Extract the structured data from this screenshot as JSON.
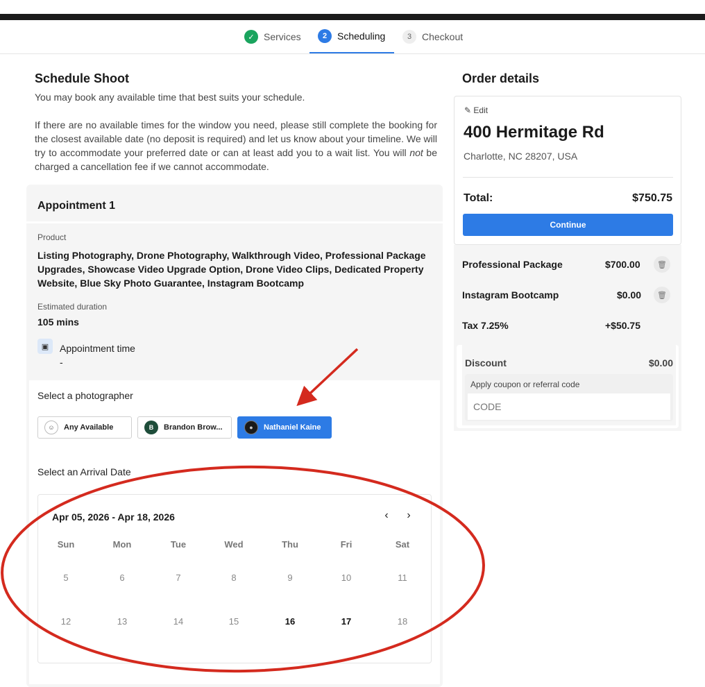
{
  "stepper": {
    "steps": [
      {
        "num": "✓",
        "label": "Services"
      },
      {
        "num": "2",
        "label": "Scheduling"
      },
      {
        "num": "3",
        "label": "Checkout"
      }
    ]
  },
  "schedule": {
    "title": "Schedule Shoot",
    "subtitle": "You may book any available time that best suits your schedule.",
    "para_before": "If there are no available times for the window you need, please still complete the booking for the closest available date (no deposit is required) and let us know about your timeline. We will try to accommodate your preferred date or can at least add you to a wait list. You will ",
    "para_emphasis": "not",
    "para_after": " be charged a cancellation fee if we cannot accommodate."
  },
  "appointment": {
    "title": "Appointment 1",
    "product_label": "Product",
    "product_value": "Listing Photography, Drone Photography, Walkthrough Video, Professional Package Upgrades, Showcase Video Upgrade Option, Drone Video Clips, Dedicated Property Website, Blue Sky Photo Guarantee, Instagram Bootcamp",
    "duration_label": "Estimated duration",
    "duration_value": "105 mins",
    "time_label": "Appointment time",
    "time_value": "-"
  },
  "photographer": {
    "label": "Select a photographer",
    "options": [
      {
        "avatar": "",
        "name": "Any Available"
      },
      {
        "avatar": "B",
        "name": "Brandon Brow..."
      },
      {
        "avatar": "",
        "name": "Nathaniel Kaine",
        "selected": true
      }
    ]
  },
  "calendar": {
    "label": "Select an Arrival Date",
    "range": "Apr 05, 2026 - Apr 18, 2026",
    "weekdays": [
      "Sun",
      "Mon",
      "Tue",
      "Wed",
      "Thu",
      "Fri",
      "Sat"
    ],
    "week1": [
      "5",
      "6",
      "7",
      "8",
      "9",
      "10",
      "11"
    ],
    "week2": [
      "12",
      "13",
      "14",
      "15",
      "16",
      "17",
      "18"
    ],
    "available_days": [
      "16",
      "17"
    ]
  },
  "order": {
    "title": "Order details",
    "edit_label": "Edit",
    "address": "400 Hermitage Rd",
    "city": "Charlotte, NC 28207, USA",
    "total_label": "Total:",
    "total_value": "$750.75",
    "continue_label": "Continue",
    "items": [
      {
        "name": "Professional Package",
        "price": "$700.00"
      },
      {
        "name": "Instagram Bootcamp",
        "price": "$0.00"
      }
    ],
    "tax_label": "Tax 7.25%",
    "tax_value": "+$50.75",
    "discount_label": "Discount",
    "discount_value": "$0.00",
    "coupon_label": "Apply coupon or referral code",
    "coupon_placeholder": "CODE"
  },
  "annotation": {
    "color": "#d42a1e"
  },
  "colors": {
    "accent": "#2d7be5",
    "success": "#1aa45e"
  }
}
